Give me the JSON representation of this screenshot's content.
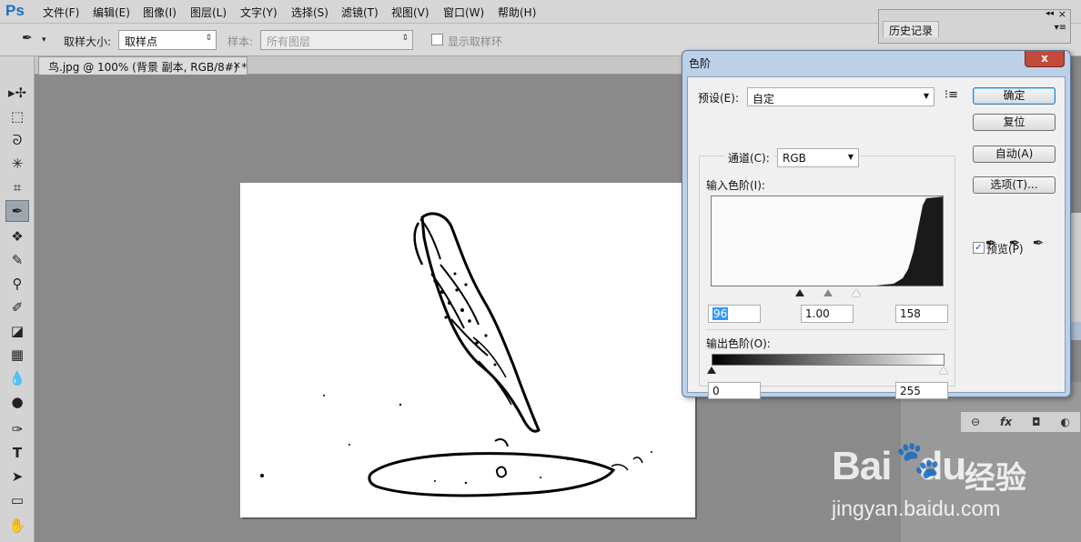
{
  "app": {
    "logo": "Ps",
    "menu": [
      "文件(F)",
      "编辑(E)",
      "图像(I)",
      "图层(L)",
      "文字(Y)",
      "选择(S)",
      "滤镜(T)",
      "视图(V)",
      "窗口(W)",
      "帮助(H)"
    ]
  },
  "options": {
    "sample_size_label": "取样大小:",
    "sample_size_value": "取样点",
    "sample_label": "样本:",
    "sample_value": "所有图层",
    "show_ring_label": "显示取样环"
  },
  "document": {
    "tab_title": "鸟.jpg @ 100% (背景 副本, RGB/8#) *",
    "tab_close": "×"
  },
  "history_panel": {
    "title": "历史记录",
    "collapse": "◂◂",
    "close": "×",
    "menu": "▾≡"
  },
  "levels": {
    "title": "色阶",
    "close": "x",
    "preset_label": "预设(E):",
    "preset_value": "自定",
    "channel_label": "通道(C):",
    "channel_value": "RGB",
    "input_label": "输入色阶(I):",
    "input_black": "96",
    "input_gamma": "1.00",
    "input_white": "158",
    "output_label": "输出色阶(O):",
    "output_black": "0",
    "output_white": "255",
    "buttons": {
      "ok": "确定",
      "reset": "复位",
      "auto": "自动(A)",
      "options": "选项(T)..."
    },
    "preview_label": "预览(P)",
    "preview_checked": true
  },
  "panel_strip_icons": [
    "link-icon",
    "fx-icon",
    "mask-icon",
    "adjustment-icon"
  ],
  "panel_strip_glyphs": [
    "⊖",
    "fx",
    "◘",
    "◐"
  ],
  "watermark": {
    "logo": "Bai",
    "logo_tail": "du",
    "text": "经验",
    "url": "jingyan.baidu.com"
  },
  "colors": {
    "ps_blue": "#1a6fc4",
    "dialog_frame": "#bcd0e8",
    "close_red": "#c24a3a",
    "selection": "#3399ff"
  }
}
